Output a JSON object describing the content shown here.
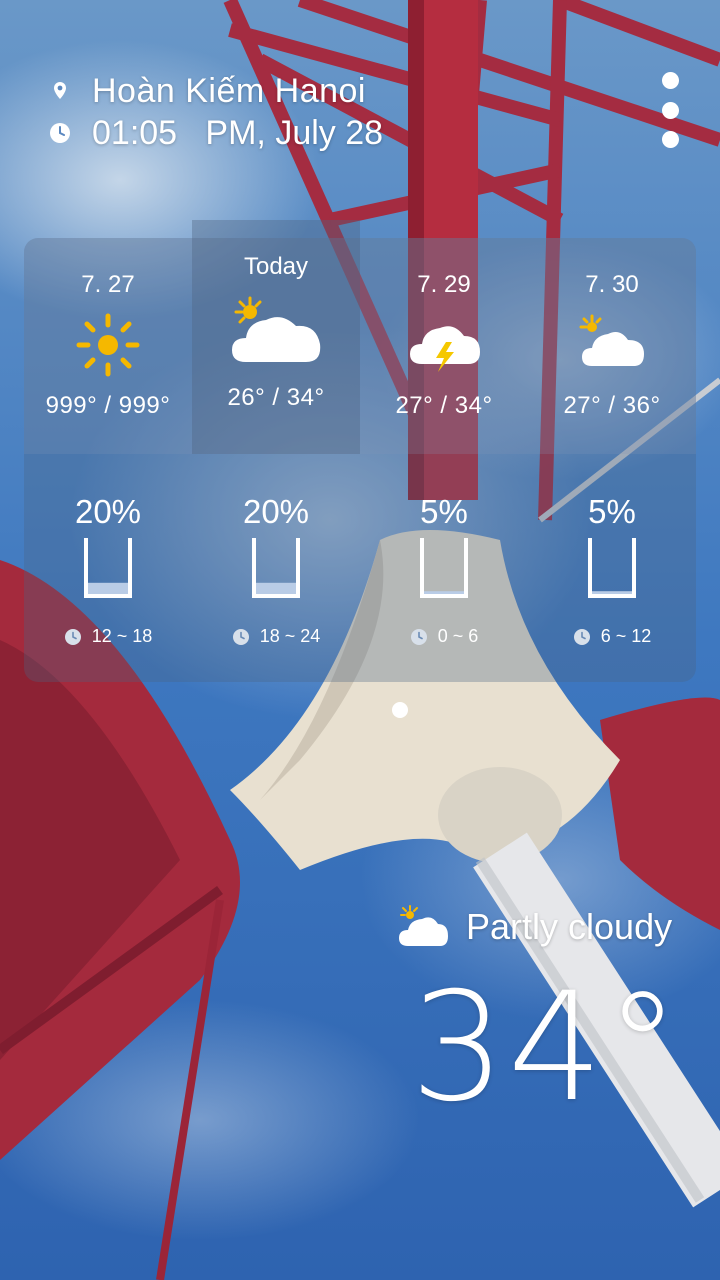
{
  "header": {
    "location": "Hoàn Kiếm Hanoi",
    "datetime": "01:05   PM, July 28"
  },
  "icons": {
    "location": "location-pin-icon",
    "clock": "clock-icon",
    "menu": "more-vert-icon"
  },
  "forecast": [
    {
      "label": "7. 27",
      "icon": "sunny-icon",
      "temps": "999° / 999°"
    },
    {
      "label": "Today",
      "icon": "partly-cloudy-icon",
      "temps": "26° / 34°"
    },
    {
      "label": "7. 29",
      "icon": "thunderstorm-icon",
      "temps": "27° / 34°"
    },
    {
      "label": "7. 30",
      "icon": "partly-cloudy-icon",
      "temps": "27° / 36°"
    }
  ],
  "rain": [
    {
      "percent": "20%",
      "level": 0.2,
      "time": "12 ~ 18"
    },
    {
      "percent": "20%",
      "level": 0.2,
      "time": "18 ~ 24"
    },
    {
      "percent": "5%",
      "level": 0.05,
      "time": "0 ~ 6"
    },
    {
      "percent": "5%",
      "level": 0.05,
      "time": "6 ~ 12"
    }
  ],
  "current": {
    "condition": "Partly cloudy",
    "condition_icon": "partly-cloudy-icon",
    "temperature": "34°"
  },
  "colors": {
    "sun": "#F5B800",
    "bolt": "#F5C800",
    "rain_fill": "#B9CCE6",
    "sky": "#3E78C0",
    "structure_red": "#A8273A"
  }
}
